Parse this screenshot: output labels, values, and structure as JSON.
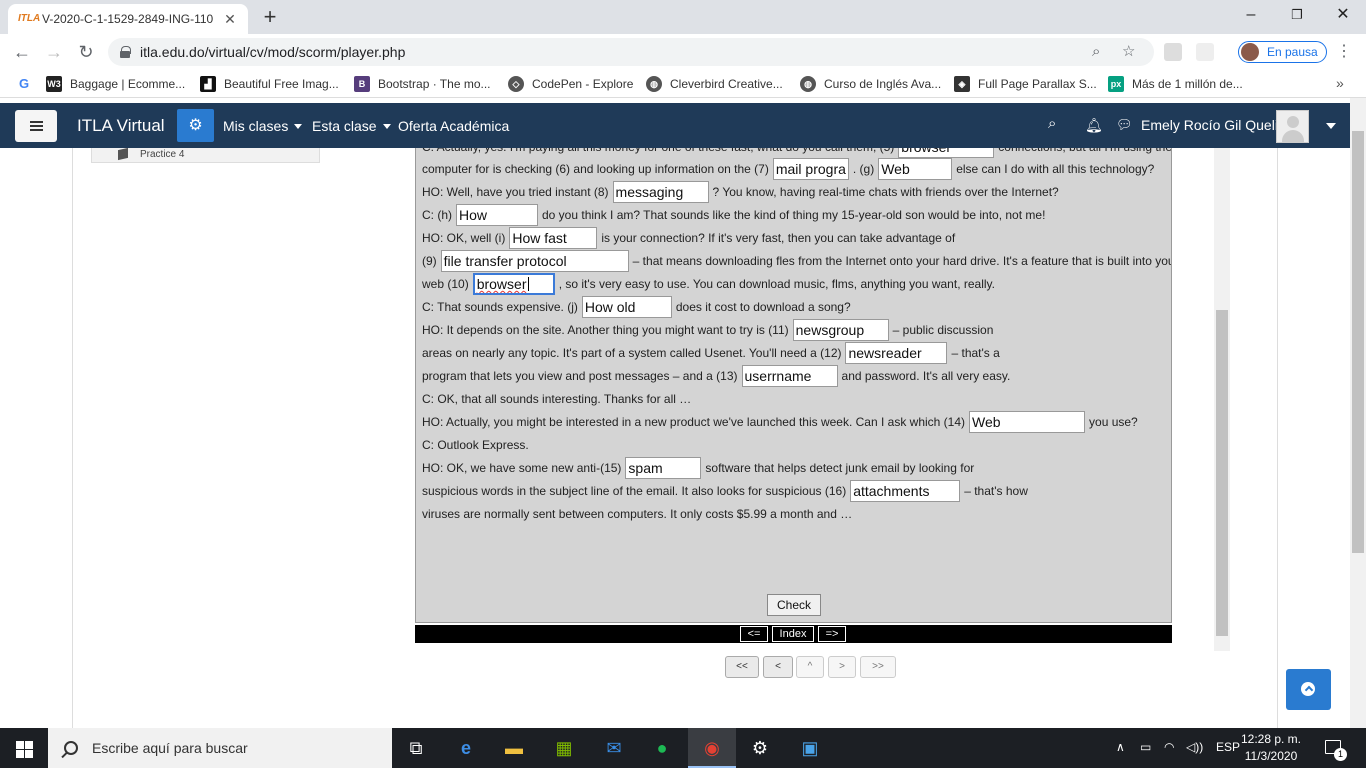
{
  "browser": {
    "tab_title": "V-2020-C-1-1529-2849-ING-110",
    "tab_favicon": "ITLA",
    "url": "itla.edu.do/virtual/cv/mod/scorm/player.php",
    "profile_status": "En pausa",
    "bookmarks": [
      {
        "label": "Baggage | Ecomme...",
        "icon": "w3-icon",
        "color": "#222222"
      },
      {
        "label": "Beautiful Free Imag...",
        "icon": "unsplash-icon",
        "color": "#111111"
      },
      {
        "label": "Bootstrap · The mo...",
        "icon": "bootstrap-icon",
        "color": "#563d7c"
      },
      {
        "label": "CodePen - Explore",
        "icon": "codepen-icon",
        "color": "#333333"
      },
      {
        "label": "Cleverbird Creative...",
        "icon": "globe-icon",
        "color": "#444444"
      },
      {
        "label": "Curso de Inglés Ava...",
        "icon": "globe-icon",
        "color": "#444444"
      },
      {
        "label": "Full Page Parallax S...",
        "icon": "codepen-icon",
        "color": "#333333"
      },
      {
        "label": "Más de 1 millón de...",
        "icon": "pexels-icon",
        "color": "#05a081"
      }
    ]
  },
  "site": {
    "brand": "ITLA Virtual",
    "nav": [
      "Mis clases",
      "Esta clase",
      "Oferta Académica"
    ],
    "username": "Emely Rocío Gil Queliz",
    "toc_item": "Practice 4"
  },
  "exercise": {
    "lines": [
      {
        "parts": [
          {
            "t": "C: Actually, yes. I'm paying all this money for one of these fast, what do you call them, (5)"
          },
          {
            "g": "browser"
          },
          {
            "t": "connections, but all I'm using the"
          }
        ]
      },
      {
        "parts": [
          {
            "t": "computer for is checking (6) and looking up information on the (7)"
          },
          {
            "g": "mail progra"
          },
          {
            "t": ". (g)"
          },
          {
            "g": "Web"
          },
          {
            "t": "else can I do with all this technology?"
          }
        ]
      },
      {
        "parts": [
          {
            "t": "HO: Well, have you tried instant (8)"
          },
          {
            "g": "messaging"
          },
          {
            "t": "? You know, having real-time chats with friends over the Internet?"
          }
        ]
      },
      {
        "parts": [
          {
            "t": "C: (h)"
          },
          {
            "g": "How"
          },
          {
            "t": "do you think I am? That sounds like the kind of thing my 15-year-old son would be into, not me!"
          }
        ]
      },
      {
        "parts": [
          {
            "t": "HO: OK, well (i)"
          },
          {
            "g": "How fast"
          },
          {
            "t": "is your connection? If it's very fast, then you can take advantage of"
          }
        ]
      },
      {
        "parts": [
          {
            "t": "(9)"
          },
          {
            "g": "file transfer protocol"
          },
          {
            "t": "– that means downloading fles from the Internet onto your hard drive. It's a feature that is built into your"
          }
        ]
      },
      {
        "parts": [
          {
            "t": "web (10)"
          },
          {
            "g": "browser",
            "active": true
          },
          {
            "t": ", so it's very easy to use. You can download music, flms, anything you want, really."
          }
        ]
      },
      {
        "parts": [
          {
            "t": "C: That sounds expensive. (j)"
          },
          {
            "g": "How old"
          },
          {
            "t": "does it cost to download a song?"
          }
        ]
      },
      {
        "parts": [
          {
            "t": "HO: It depends on the site. Another thing you might want to try is (11)"
          },
          {
            "g": "newsgroup"
          },
          {
            "t": "– public discussion"
          }
        ]
      },
      {
        "parts": [
          {
            "t": "areas on nearly any topic. It's part of a system called Usenet. You'll need a (12)"
          },
          {
            "g": "newsreader"
          },
          {
            "t": "– that's a"
          }
        ]
      },
      {
        "parts": [
          {
            "t": "program that lets you view and post messages – and a (13)"
          },
          {
            "g": "userrname"
          },
          {
            "t": "and password. It's all very easy."
          }
        ]
      },
      {
        "parts": [
          {
            "t": "C: OK, that all sounds interesting. Thanks for all …"
          }
        ]
      },
      {
        "parts": [
          {
            "t": "HO: Actually, you might be interested in a new product we've launched this week. Can I ask which (14)"
          },
          {
            "g": "Web"
          },
          {
            "t": "you use?"
          }
        ]
      },
      {
        "parts": [
          {
            "t": "C: Outlook Express."
          }
        ]
      },
      {
        "parts": [
          {
            "t": "HO: OK, we have some new anti-(15)"
          },
          {
            "g": "spam"
          },
          {
            "t": "software that helps detect junk email by looking for"
          }
        ]
      },
      {
        "parts": [
          {
            "t": "suspicious words in the subject line of the email. It also looks for suspicious (16)"
          },
          {
            "g": "attachments"
          },
          {
            "t": "– that's how"
          }
        ]
      },
      {
        "parts": [
          {
            "t": "viruses are normally sent between computers. It only costs $5.99 a month and …"
          }
        ]
      }
    ],
    "check_label": "Check",
    "nav_prev": "<=",
    "nav_index": "Index",
    "nav_next": "=>",
    "pager": [
      "<<",
      "<",
      "^",
      ">",
      ">>"
    ]
  },
  "taskbar": {
    "search_placeholder": "Escribe aquí para buscar",
    "language": "ESP",
    "time": "12:28 p. m.",
    "date": "11/3/2020",
    "notifications": "1"
  }
}
